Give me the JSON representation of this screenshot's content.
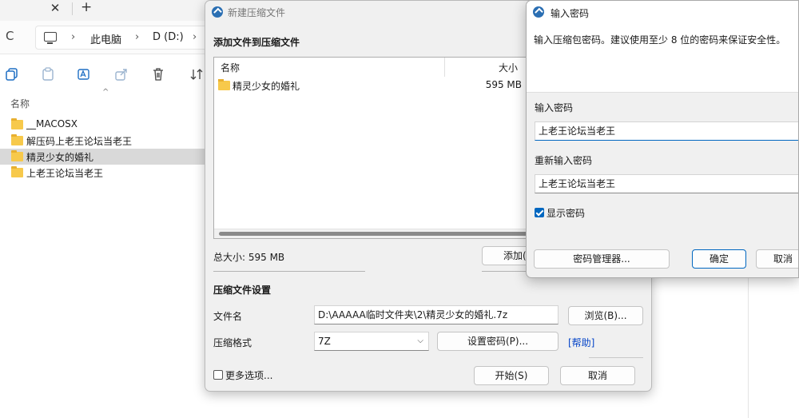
{
  "explorer": {
    "tab_close": "✕",
    "tab_new": "+",
    "refresh": "C",
    "breadcrumb": [
      "此电脑",
      "D (D:)"
    ],
    "column_name": "名称",
    "files": [
      {
        "name": "__MACOSX",
        "selected": false
      },
      {
        "name": "解压码上老王论坛当老王",
        "selected": false
      },
      {
        "name": "精灵少女的婚礼",
        "selected": true
      },
      {
        "name": "上老王论坛当老王",
        "selected": false
      }
    ]
  },
  "archive_dialog": {
    "title": "新建压缩文件",
    "add_section": "添加文件到压缩文件",
    "list_header_name": "名称",
    "list_header_size": "大小",
    "list_items": [
      {
        "name": "精灵少女的婚礼",
        "size": "595 MB"
      }
    ],
    "total_size": "总大小: 595 MB",
    "add_button": "添加(",
    "settings_section": "压缩文件设置",
    "filename_label": "文件名",
    "filename_value": "D:\\AAAAA临时文件夹\\2\\精灵少女的婚礼.7z",
    "browse_button": "浏览(B)...",
    "format_label": "压缩格式",
    "format_value": "7Z",
    "set_password_button": "设置密码(P)...",
    "help_link": "[帮助]",
    "more_options": "更多选项...",
    "more_options_checked": false,
    "start_button": "开始(S)",
    "cancel_button": "取消"
  },
  "password_dialog": {
    "title": "输入密码",
    "description": "输入压缩包密码。建议使用至少 8 位的密码来保证安全性。",
    "enter_label": "输入密码",
    "enter_value": "上老王论坛当老王",
    "reenter_label": "重新输入密码",
    "reenter_value": "上老王论坛当老王",
    "show_password_label": "显示密码",
    "show_password_checked": true,
    "manager_button": "密码管理器...",
    "ok_button": "确定",
    "cancel_button": "取消"
  },
  "colors": {
    "accent": "#0067c0",
    "folder": "#f7c94b",
    "selection": "#d9d9d9",
    "link": "#0645c8"
  }
}
